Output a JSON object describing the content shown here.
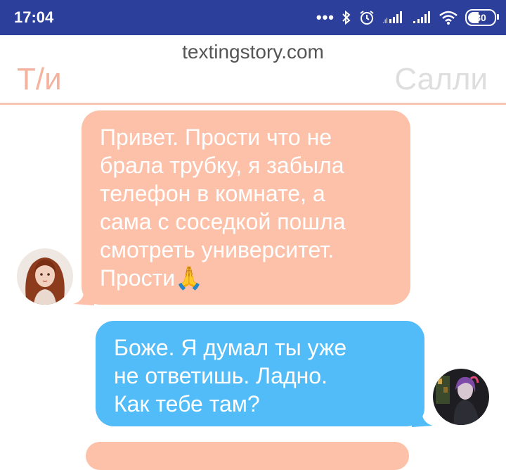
{
  "status_bar": {
    "time": "17:04",
    "battery": "30",
    "icons": [
      "dots-icon",
      "bluetooth-icon",
      "alarm-icon",
      "signal-icon",
      "signal-icon",
      "wifi-icon",
      "battery-icon"
    ]
  },
  "header": {
    "site": "textingstory.com",
    "left_name": "Т/и",
    "right_name": "Салли"
  },
  "messages": [
    {
      "sender": "Т/и",
      "lines": [
        "Привет. Прости что не",
        "брала трубку, я забыла",
        "телефон в комнате, а",
        "сама с соседкой пошла",
        "смотреть университет.",
        "Прости"
      ],
      "emoji": "🙏"
    },
    {
      "sender": "Салли",
      "lines": [
        "Боже. Я думал ты уже",
        "не ответишь. Ладно.",
        "Как тебе там?"
      ]
    }
  ],
  "colors": {
    "status_bar": "#2b3f9b",
    "left_bubble": "#fdc1aa",
    "right_bubble": "#52bcf9",
    "left_name": "#f4b39e",
    "right_name": "#dedede"
  }
}
